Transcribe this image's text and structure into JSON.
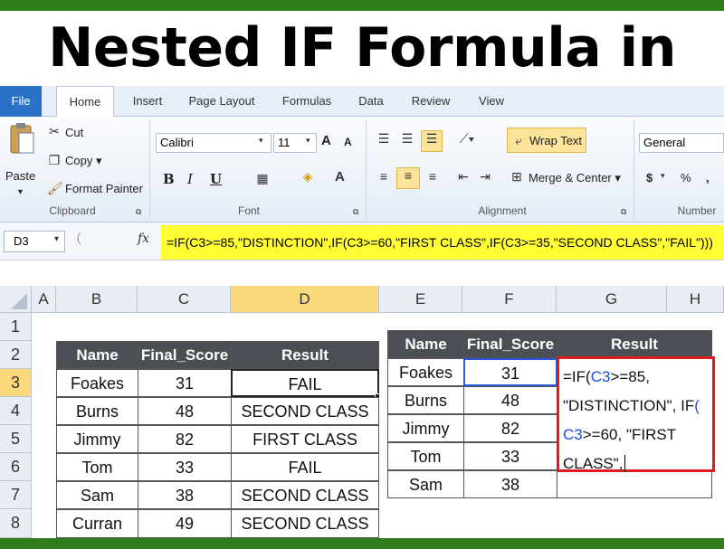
{
  "banner": {
    "title": "Nested IF Formula in Excel"
  },
  "tabs": [
    "File",
    "Home",
    "Insert",
    "Page Layout",
    "Formulas",
    "Data",
    "Review",
    "View"
  ],
  "clipboard": {
    "paste": "Paste",
    "cut": "Cut",
    "copy": "Copy ▾",
    "format_painter": "Format Painter",
    "label": "Clipboard"
  },
  "font": {
    "name": "Calibri",
    "size": "11",
    "grow": "A",
    "shrink": "A",
    "bold": "B",
    "italic": "I",
    "underline": "U",
    "label": "Font"
  },
  "alignment": {
    "wrap_text": "Wrap Text",
    "merge_center": "Merge & Center ▾",
    "label": "Alignment"
  },
  "number": {
    "format": "General",
    "currency": "$",
    "percent": "%",
    "comma": ",",
    "label": "Number"
  },
  "formula_bar": {
    "name_box": "D3",
    "fx": "fx",
    "formula": "=IF(C3>=85,\"DISTINCTION\",IF(C3>=60,\"FIRST CLASS\",IF(C3>=35,\"SECOND CLASS\",\"FAIL\")))"
  },
  "columns": [
    "A",
    "B",
    "C",
    "D",
    "E",
    "F",
    "G",
    "H"
  ],
  "rows": [
    "1",
    "2",
    "3",
    "4",
    "5",
    "6",
    "7",
    "8"
  ],
  "table1": {
    "headers": [
      "Name",
      "Final_Score",
      "Result"
    ],
    "rows": [
      [
        "Foakes",
        "31",
        "FAIL"
      ],
      [
        "Burns",
        "48",
        "SECOND CLASS"
      ],
      [
        "Jimmy",
        "82",
        "FIRST CLASS"
      ],
      [
        "Tom",
        "33",
        "FAIL"
      ],
      [
        "Sam",
        "38",
        "SECOND CLASS"
      ],
      [
        "Curran",
        "49",
        "SECOND CLASS"
      ]
    ]
  },
  "table2": {
    "headers": [
      "Name",
      "Final_Score",
      "Result"
    ],
    "rows": [
      [
        "Foakes",
        "31"
      ],
      [
        "Burns",
        "48"
      ],
      [
        "Jimmy",
        "82"
      ],
      [
        "Tom",
        "33"
      ],
      [
        "Sam",
        "38"
      ]
    ]
  },
  "editor": {
    "l1a": "=IF(",
    "l1b": "C3",
    "l1c": ">=85,",
    "l2a": "\"DISTINCTION\", IF",
    "l2b": "(",
    "l3a": "C3",
    "l3b": ">=60, \"FIRST",
    "l4a": "CLASS\","
  },
  "colors": {
    "accent_green": "#2e7d1a",
    "formula_highlight": "#ffff33",
    "editor_border": "#e01b1b",
    "header_fill": "#4a4f55"
  }
}
